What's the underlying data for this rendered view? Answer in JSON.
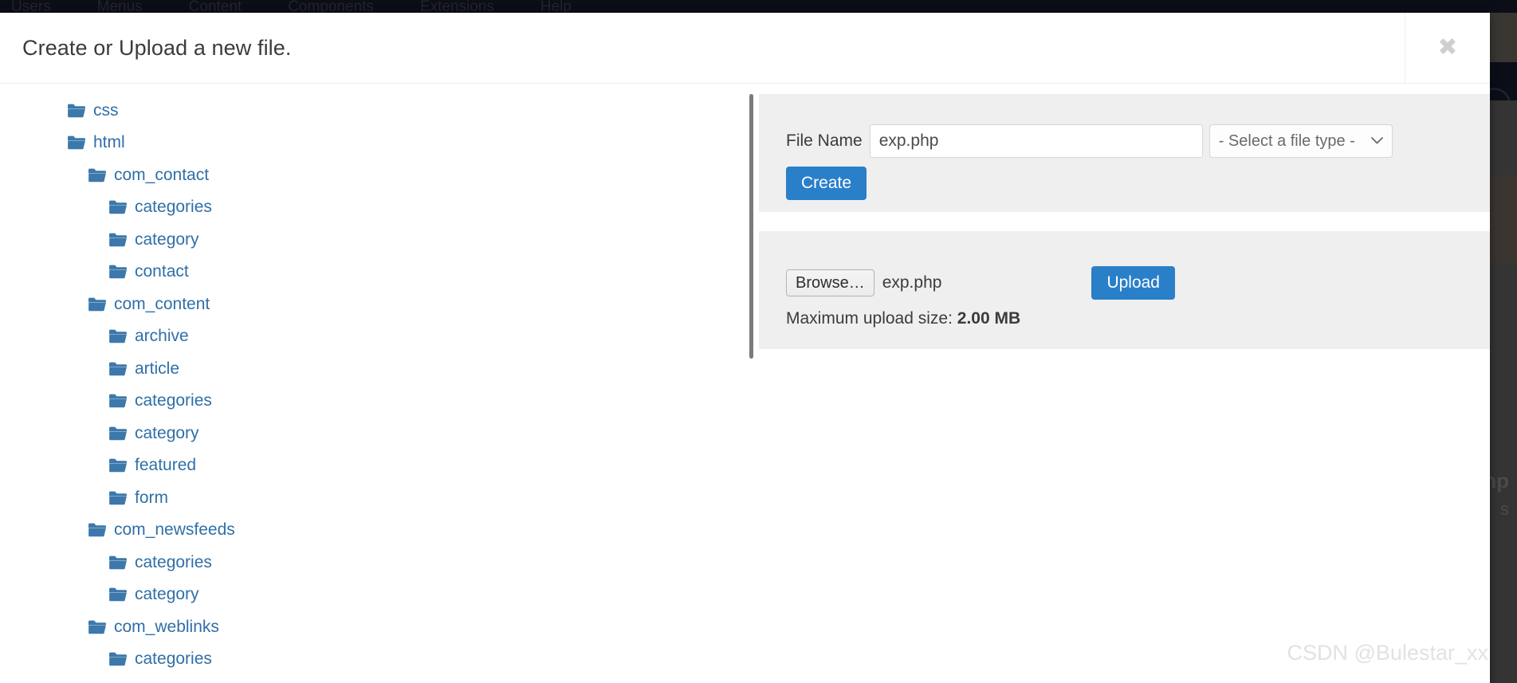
{
  "backdrop": {
    "menubar_items": [
      "Users",
      "Menus",
      "Content",
      "Components",
      "Extensions",
      "Help"
    ],
    "search_icon": "search-icon",
    "fragment_texts": [
      "mp",
      "s"
    ]
  },
  "modal": {
    "title": "Create or Upload a new file.",
    "close_label": "✖"
  },
  "tree": {
    "items": [
      {
        "label": "css",
        "depth": 0
      },
      {
        "label": "html",
        "depth": 0
      },
      {
        "label": "com_contact",
        "depth": 1
      },
      {
        "label": "categories",
        "depth": 2
      },
      {
        "label": "category",
        "depth": 2
      },
      {
        "label": "contact",
        "depth": 2
      },
      {
        "label": "com_content",
        "depth": 1
      },
      {
        "label": "archive",
        "depth": 2
      },
      {
        "label": "article",
        "depth": 2
      },
      {
        "label": "categories",
        "depth": 2
      },
      {
        "label": "category",
        "depth": 2
      },
      {
        "label": "featured",
        "depth": 2
      },
      {
        "label": "form",
        "depth": 2
      },
      {
        "label": "com_newsfeeds",
        "depth": 1
      },
      {
        "label": "categories",
        "depth": 2
      },
      {
        "label": "category",
        "depth": 2
      },
      {
        "label": "com_weblinks",
        "depth": 1
      },
      {
        "label": "categories",
        "depth": 2
      }
    ]
  },
  "create_panel": {
    "file_name_label": "File Name",
    "file_name_value": "exp.php",
    "file_name_placeholder": "",
    "file_type_selected": "- Select a file type -",
    "file_type_options": [
      "- Select a file type -"
    ],
    "create_label": "Create"
  },
  "upload_panel": {
    "browse_label": "Browse…",
    "selected_file": "exp.php",
    "max_size_label": "Maximum upload size:",
    "max_size_value": "2.00 MB",
    "upload_label": "Upload"
  },
  "watermark": {
    "text": "CSDN @Bulestar_xx"
  },
  "colors": {
    "primary": "#2a7fc9",
    "panel_bg": "#efefef",
    "tree_link": "#2f6fa7",
    "folder": "#3c78ab",
    "divider": "#7b7b7b"
  }
}
